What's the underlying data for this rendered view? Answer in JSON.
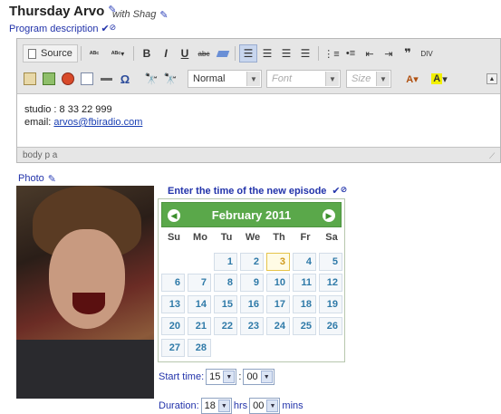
{
  "episode": {
    "title": "Thursday Arvo",
    "with_label": "with Shag",
    "program_description_label": "Program description"
  },
  "editor": {
    "source_label": "Source",
    "format_select": "Normal",
    "font_select": "Font",
    "size_select": "Size",
    "content_line1": "studio : 8 33 22 999",
    "email_prefix": "email: ",
    "email_link": "arvos@fbiradio.com",
    "status_path": "body  p  a"
  },
  "photo": {
    "label": "Photo"
  },
  "schedule": {
    "enter_label": "Enter the time of the new episode",
    "start_label": "Start time:",
    "start_hour": "15",
    "time_sep": ":",
    "start_min": "00",
    "duration_label": "Duration:",
    "duration_hrs": "18",
    "hrs_label": "hrs",
    "duration_mins": "00",
    "mins_label": "mins"
  },
  "calendar": {
    "month_label": "February 2011",
    "days_of_week": [
      "Su",
      "Mo",
      "Tu",
      "We",
      "Th",
      "Fr",
      "Sa"
    ],
    "first_weekday": 2,
    "num_days": 28,
    "today": 3
  },
  "colors": {
    "accent_blue": "#2233aa",
    "calendar_header": "#5aa84a",
    "today_highlight": "#e5c44b"
  }
}
